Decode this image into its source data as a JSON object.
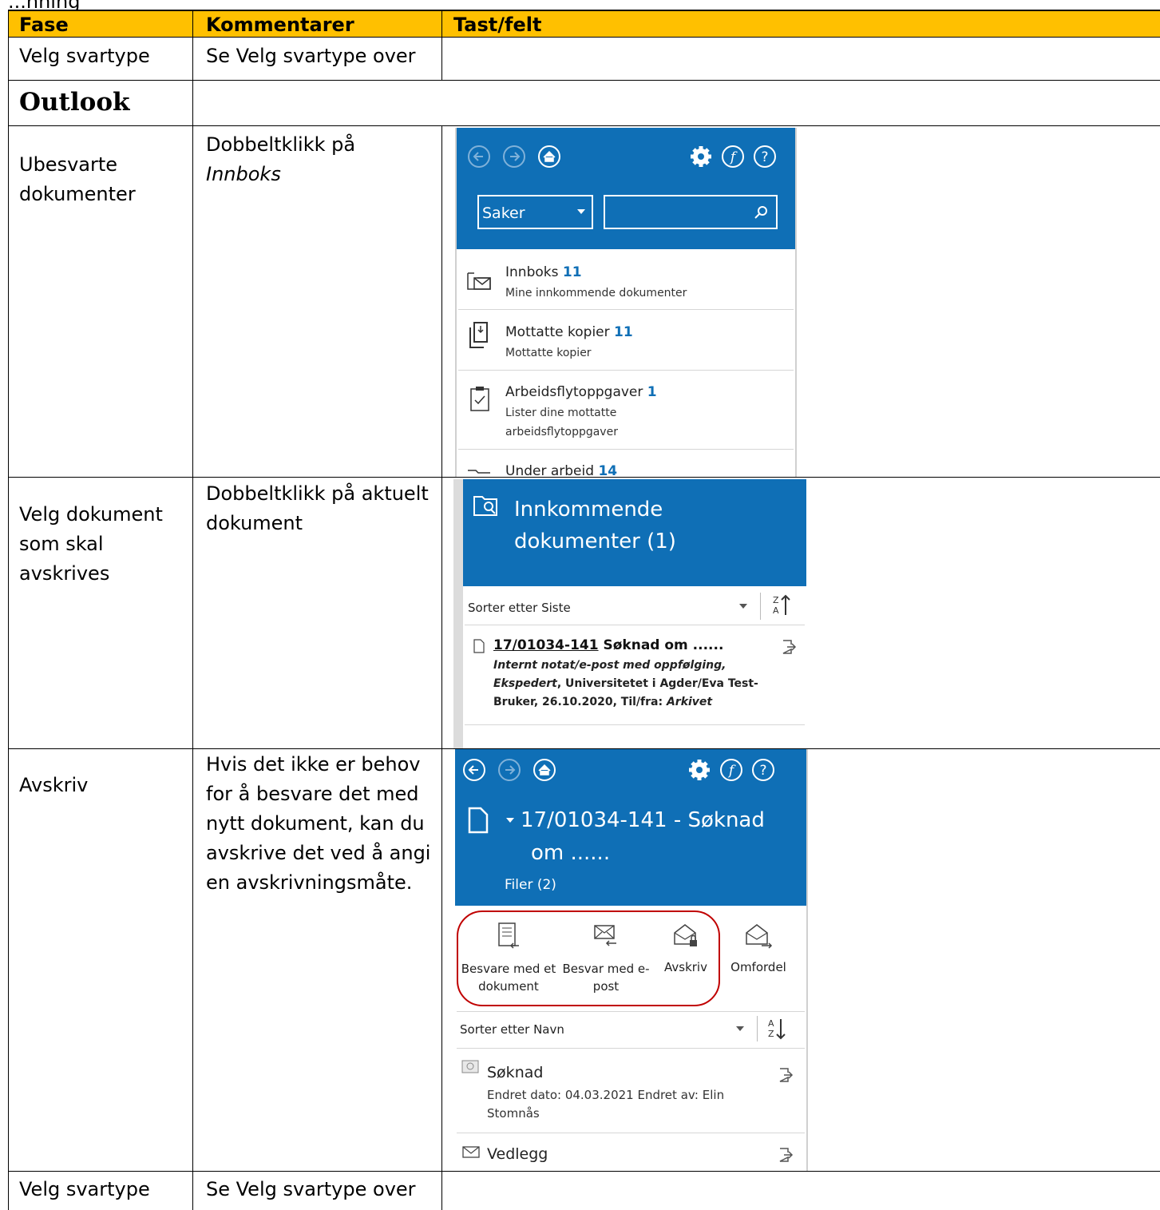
{
  "top_fragment": "...nning",
  "table": {
    "headers": [
      "Fase",
      "Kommentarer",
      "Tast/felt"
    ],
    "rows": [
      {
        "fase": "Velg svartype",
        "kommentar": "Se Velg svartype over"
      },
      {
        "section": "Outlook"
      },
      {
        "fase": [
          "Ubesvarte",
          "dokumenter"
        ],
        "kommentar_line1": "Dobbeltklikk på",
        "kommentar_line2": "Innboks"
      },
      {
        "fase": [
          "Velg dokument",
          "som skal",
          "avskrives"
        ],
        "kommentar": [
          "Dobbeltklikk på aktuelt",
          "dokument"
        ]
      },
      {
        "fase": "Avskriv",
        "kommentar": [
          "Hvis det ikke er behov",
          "for å besvare det med",
          "nytt dokument, kan du",
          "avskrive det ved å angi",
          "en avskrivningsmåte."
        ]
      },
      {
        "fase": "Velg svartype",
        "kommentar": "Se Velg svartype over"
      }
    ]
  },
  "panel1": {
    "dropdown": "Saker",
    "items": [
      {
        "title": "Innboks",
        "count": "11",
        "sub": [
          "Mine innkommende dokumenter"
        ]
      },
      {
        "title": "Mottatte kopier",
        "count": "11",
        "sub": [
          "Mottatte kopier"
        ]
      },
      {
        "title": "Arbeidsflytoppgaver",
        "count": "1",
        "sub": [
          "Lister dine mottatte",
          "arbeidsflytoppgaver"
        ]
      },
      {
        "title": "Under arbeid",
        "count": "14",
        "sub": []
      }
    ]
  },
  "panel2": {
    "title": [
      "Innkommende",
      "dokumenter (1)"
    ],
    "sort_label": "Sorter etter Siste",
    "sort_icon": "Z\nA",
    "doc": {
      "number": "17/01034-141",
      "title": "Søknad om ......",
      "line1": "Internt notat/e-post med oppfølging,",
      "line2_italic": "Ekspedert",
      "line2_rest": ", Universitetet i Agder/Eva Test-",
      "line3_rest": "Bruker, 26.10.2020, Til/fra: ",
      "line3_italic": "Arkivet"
    }
  },
  "panel3": {
    "title_line1": "17/01034-141 - Søknad",
    "title_line2": "om ......",
    "files": "Filer (2)",
    "actions": [
      {
        "label": [
          "Besvare med et",
          "dokument"
        ]
      },
      {
        "label": [
          "Besvar med e-",
          "post"
        ]
      },
      {
        "label": [
          "Avskriv"
        ]
      },
      {
        "label": [
          "Omfordel"
        ]
      }
    ],
    "sort_label": "Sorter etter Navn",
    "files_list": [
      {
        "name": "Søknad",
        "meta": [
          "Endret dato: 04.03.2021 Endret av: Elin",
          "Stomnås"
        ]
      },
      {
        "name": "Vedlegg",
        "meta": []
      }
    ]
  },
  "colors": {
    "header": "#ffc000",
    "panel_blue": "#0f6fb6",
    "highlight_red": "#c00000"
  }
}
